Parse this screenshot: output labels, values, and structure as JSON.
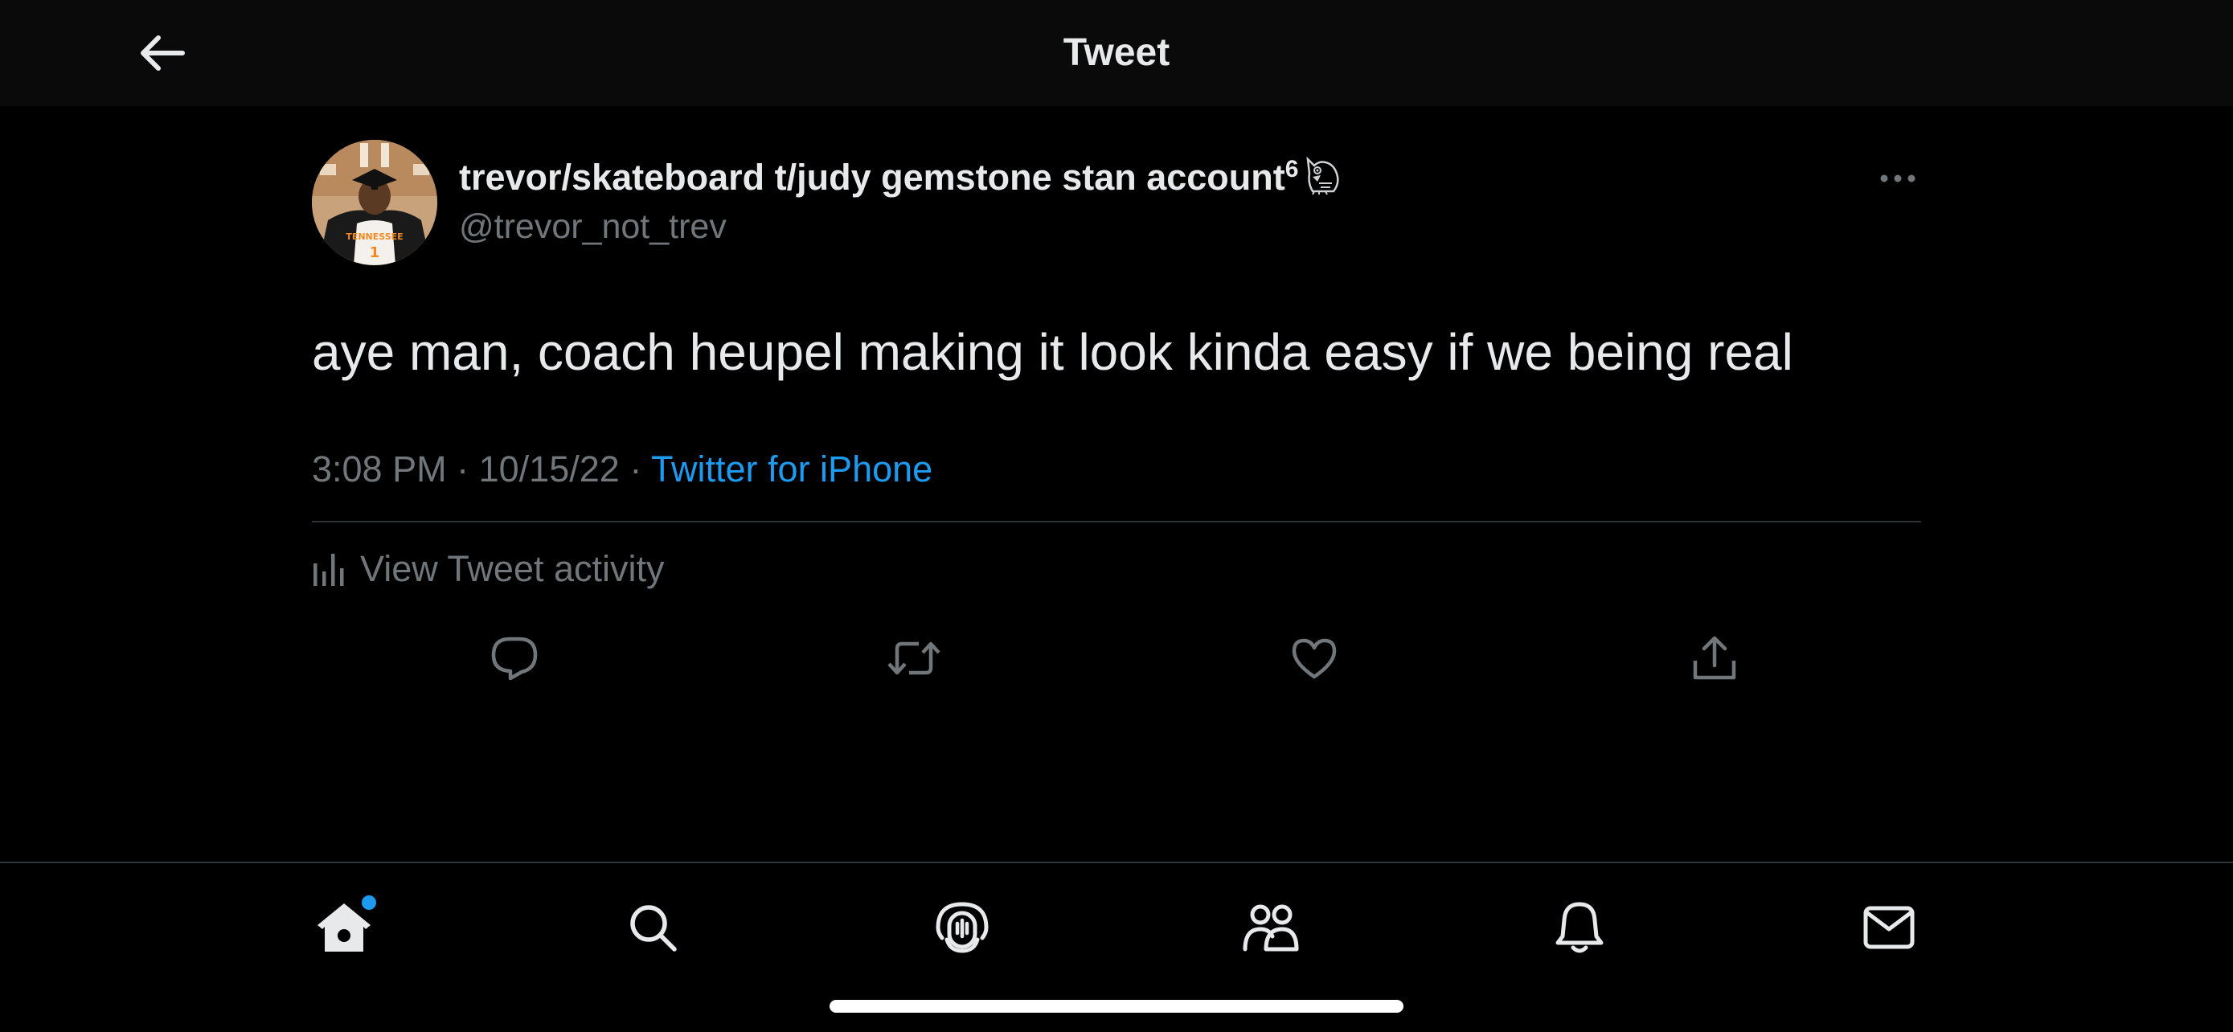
{
  "header": {
    "title": "Tweet",
    "back_icon": "arrow-left-icon"
  },
  "tweet": {
    "display_name": "trevor/skateboard t/judy gemstone stan account",
    "display_name_superscript": "6",
    "display_name_emoji": "owl-icon",
    "handle": "@trevor_not_trev",
    "text": "aye man, coach heupel making it look kinda easy if we being real",
    "time": "3:08 PM",
    "date": "10/15/22",
    "separator": "·",
    "source": "Twitter for iPhone",
    "activity_label": "View Tweet activity",
    "more_icon": "more-horizontal-icon"
  },
  "actions": [
    {
      "name": "reply",
      "icon": "reply-icon"
    },
    {
      "name": "retweet",
      "icon": "retweet-icon"
    },
    {
      "name": "like",
      "icon": "heart-icon"
    },
    {
      "name": "share",
      "icon": "share-icon"
    }
  ],
  "bottom_nav": [
    {
      "name": "home",
      "icon": "home-icon",
      "active": true,
      "has_notification_dot": true
    },
    {
      "name": "search",
      "icon": "search-icon",
      "active": false
    },
    {
      "name": "spaces",
      "icon": "spaces-icon",
      "active": false
    },
    {
      "name": "communities",
      "icon": "communities-icon",
      "active": false
    },
    {
      "name": "notifications",
      "icon": "bell-icon",
      "active": false
    },
    {
      "name": "messages",
      "icon": "mail-icon",
      "active": false
    }
  ],
  "colors": {
    "background": "#000000",
    "header_background": "#0a0a0a",
    "primary_text": "#e7e9ea",
    "secondary_text": "#71767b",
    "accent": "#1d9bf0",
    "divider": "#2f3336"
  }
}
